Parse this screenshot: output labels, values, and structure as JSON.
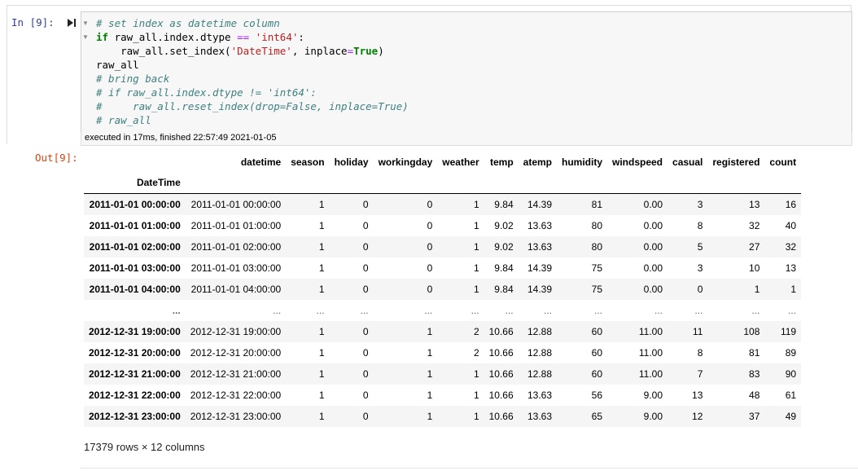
{
  "prompts": {
    "in": "In [9]:",
    "out": "Out[9]:"
  },
  "code": {
    "lines": [
      {
        "parts": [
          [
            "cm",
            "# set index as datetime column"
          ]
        ]
      },
      {
        "parts": [
          [
            "kw",
            "if"
          ],
          [
            "pl",
            " raw_all.index.dtype "
          ],
          [
            "op",
            "=="
          ],
          [
            "pl",
            " "
          ],
          [
            "str",
            "'int64'"
          ],
          [
            "pl",
            ":"
          ]
        ]
      },
      {
        "parts": [
          [
            "pl",
            "    raw_all.set_index("
          ],
          [
            "str",
            "'DateTime'"
          ],
          [
            "pl",
            ", inplace"
          ],
          [
            "op",
            "="
          ],
          [
            "kw",
            "True"
          ],
          [
            "pl",
            ")"
          ]
        ]
      },
      {
        "parts": [
          [
            "pl",
            "raw_all"
          ]
        ]
      },
      {
        "parts": [
          [
            "cm",
            "# bring back"
          ]
        ]
      },
      {
        "parts": [
          [
            "cm",
            "# if raw_all.index.dtype != 'int64':"
          ]
        ]
      },
      {
        "parts": [
          [
            "cm",
            "#     raw_all.reset_index(drop=False, inplace=True)"
          ]
        ]
      },
      {
        "parts": [
          [
            "cm",
            "# raw_all"
          ]
        ]
      }
    ]
  },
  "execution": {
    "status_text": "executed in 17ms, finished 22:57:49 2021-01-05"
  },
  "dataframe": {
    "index_name": "DateTime",
    "columns": [
      "datetime",
      "season",
      "holiday",
      "workingday",
      "weather",
      "temp",
      "atemp",
      "humidity",
      "windspeed",
      "casual",
      "registered",
      "count"
    ],
    "rows": [
      {
        "index": "2011-01-01 00:00:00",
        "values": [
          "2011-01-01 00:00:00",
          "1",
          "0",
          "0",
          "1",
          "9.84",
          "14.39",
          "81",
          "0.00",
          "3",
          "13",
          "16"
        ]
      },
      {
        "index": "2011-01-01 01:00:00",
        "values": [
          "2011-01-01 01:00:00",
          "1",
          "0",
          "0",
          "1",
          "9.02",
          "13.63",
          "80",
          "0.00",
          "8",
          "32",
          "40"
        ]
      },
      {
        "index": "2011-01-01 02:00:00",
        "values": [
          "2011-01-01 02:00:00",
          "1",
          "0",
          "0",
          "1",
          "9.02",
          "13.63",
          "80",
          "0.00",
          "5",
          "27",
          "32"
        ]
      },
      {
        "index": "2011-01-01 03:00:00",
        "values": [
          "2011-01-01 03:00:00",
          "1",
          "0",
          "0",
          "1",
          "9.84",
          "14.39",
          "75",
          "0.00",
          "3",
          "10",
          "13"
        ]
      },
      {
        "index": "2011-01-01 04:00:00",
        "values": [
          "2011-01-01 04:00:00",
          "1",
          "0",
          "0",
          "1",
          "9.84",
          "14.39",
          "75",
          "0.00",
          "0",
          "1",
          "1"
        ]
      },
      {
        "index": "...",
        "ellipsis": true,
        "values": [
          "...",
          "...",
          "...",
          "...",
          "...",
          "...",
          "...",
          "...",
          "...",
          "...",
          "...",
          "..."
        ]
      },
      {
        "index": "2012-12-31 19:00:00",
        "values": [
          "2012-12-31 19:00:00",
          "1",
          "0",
          "1",
          "2",
          "10.66",
          "12.88",
          "60",
          "11.00",
          "11",
          "108",
          "119"
        ]
      },
      {
        "index": "2012-12-31 20:00:00",
        "values": [
          "2012-12-31 20:00:00",
          "1",
          "0",
          "1",
          "2",
          "10.66",
          "12.88",
          "60",
          "11.00",
          "8",
          "81",
          "89"
        ]
      },
      {
        "index": "2012-12-31 21:00:00",
        "values": [
          "2012-12-31 21:00:00",
          "1",
          "0",
          "1",
          "1",
          "10.66",
          "12.88",
          "60",
          "11.00",
          "7",
          "83",
          "90"
        ]
      },
      {
        "index": "2012-12-31 22:00:00",
        "values": [
          "2012-12-31 22:00:00",
          "1",
          "0",
          "1",
          "1",
          "10.66",
          "13.63",
          "56",
          "9.00",
          "13",
          "48",
          "61"
        ]
      },
      {
        "index": "2012-12-31 23:00:00",
        "values": [
          "2012-12-31 23:00:00",
          "1",
          "0",
          "1",
          "1",
          "10.66",
          "13.63",
          "65",
          "9.00",
          "12",
          "37",
          "49"
        ]
      }
    ],
    "shape_text": "17379 rows × 12 columns"
  },
  "icons": {
    "run": "run-cell-icon",
    "fold": "fold-arrow-icon"
  },
  "colors": {
    "in_prompt": "#303f9f",
    "out_prompt": "#d84315",
    "comment": "#408080",
    "keyword": "#008000",
    "string": "#ba2121",
    "operator": "#aa22ff"
  }
}
